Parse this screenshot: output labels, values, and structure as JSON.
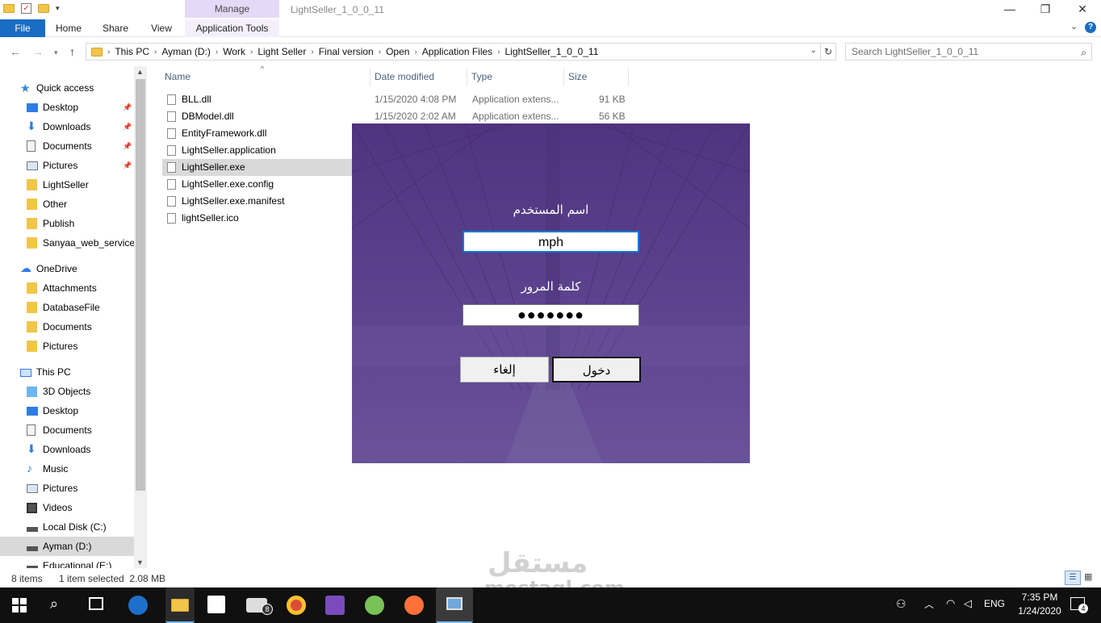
{
  "window": {
    "title": "LightSeller_1_0_0_11",
    "manage_tab": "Manage",
    "minimize": "—",
    "restore": "❐",
    "close": "✕"
  },
  "ribbon": {
    "tabs": [
      "File",
      "Home",
      "Share",
      "View",
      "Application Tools"
    ]
  },
  "address": {
    "crumbs": [
      "This PC",
      "Ayman (D:)",
      "Work",
      "Light Seller",
      "Final version",
      "Open",
      "Application Files",
      "LightSeller_1_0_0_11"
    ],
    "search_placeholder": "Search LightSeller_1_0_0_11"
  },
  "nav": {
    "items": [
      {
        "label": "Quick access",
        "icon": "star-icon"
      },
      {
        "label": "Desktop",
        "icon": "desktop-icon",
        "pinned": true
      },
      {
        "label": "Downloads",
        "icon": "download-icon",
        "pinned": true
      },
      {
        "label": "Documents",
        "icon": "documents-icon",
        "pinned": true
      },
      {
        "label": "Pictures",
        "icon": "pictures-icon",
        "pinned": true
      },
      {
        "label": "LightSeller",
        "icon": "folder-icon"
      },
      {
        "label": "Other",
        "icon": "folder-icon"
      },
      {
        "label": "Publish",
        "icon": "folder-icon"
      },
      {
        "label": "Sanyaa_web_service",
        "icon": "folder-icon"
      },
      {
        "label": "OneDrive",
        "icon": "cloud-icon"
      },
      {
        "label": "Attachments",
        "icon": "folder-icon"
      },
      {
        "label": "DatabaseFile",
        "icon": "folder-icon"
      },
      {
        "label": "Documents",
        "icon": "folder-icon"
      },
      {
        "label": "Pictures",
        "icon": "folder-icon"
      },
      {
        "label": "This PC",
        "icon": "computer-icon"
      },
      {
        "label": "3D Objects",
        "icon": "3d-objects-icon"
      },
      {
        "label": "Desktop",
        "icon": "desktop-icon"
      },
      {
        "label": "Documents",
        "icon": "documents-icon"
      },
      {
        "label": "Downloads",
        "icon": "download-icon"
      },
      {
        "label": "Music",
        "icon": "music-icon"
      },
      {
        "label": "Pictures",
        "icon": "pictures-icon"
      },
      {
        "label": "Videos",
        "icon": "videos-icon"
      },
      {
        "label": "Local Disk (C:)",
        "icon": "drive-icon"
      },
      {
        "label": "Ayman (D:)",
        "icon": "drive-icon",
        "selected": true
      },
      {
        "label": "Educational (E:)",
        "icon": "drive-icon"
      }
    ]
  },
  "columns": [
    "Name",
    "Date modified",
    "Type",
    "Size"
  ],
  "files": [
    {
      "name": "BLL.dll",
      "date": "1/15/2020 4:08 PM",
      "type": "Application extens...",
      "size": "91 KB"
    },
    {
      "name": "DBModel.dll",
      "date": "1/15/2020 2:02 AM",
      "type": "Application extens...",
      "size": "56 KB"
    },
    {
      "name": "EntityFramework.dll"
    },
    {
      "name": "LightSeller.application"
    },
    {
      "name": "LightSeller.exe",
      "selected": true
    },
    {
      "name": "LightSeller.exe.config"
    },
    {
      "name": "LightSeller.exe.manifest"
    },
    {
      "name": "lightSeller.ico"
    }
  ],
  "status": {
    "items": "8 items",
    "selection": "1 item selected  2.08 MB"
  },
  "dialog": {
    "username_label": "اسم المستخدم",
    "username_value": "mph",
    "password_label": "كلمة المرور",
    "password_mask": "●●●●●●●",
    "login_button": "دخول",
    "cancel_button": "إلغاء",
    "bg_color": "#5a3f8a"
  },
  "taskbar": {
    "mail_badge": "8",
    "lang": "ENG",
    "time": "7:35 PM",
    "date": "1/24/2020",
    "notif_count": "4"
  },
  "watermark": {
    "arabic": "مستقل",
    "latin": "mostaql.com"
  }
}
